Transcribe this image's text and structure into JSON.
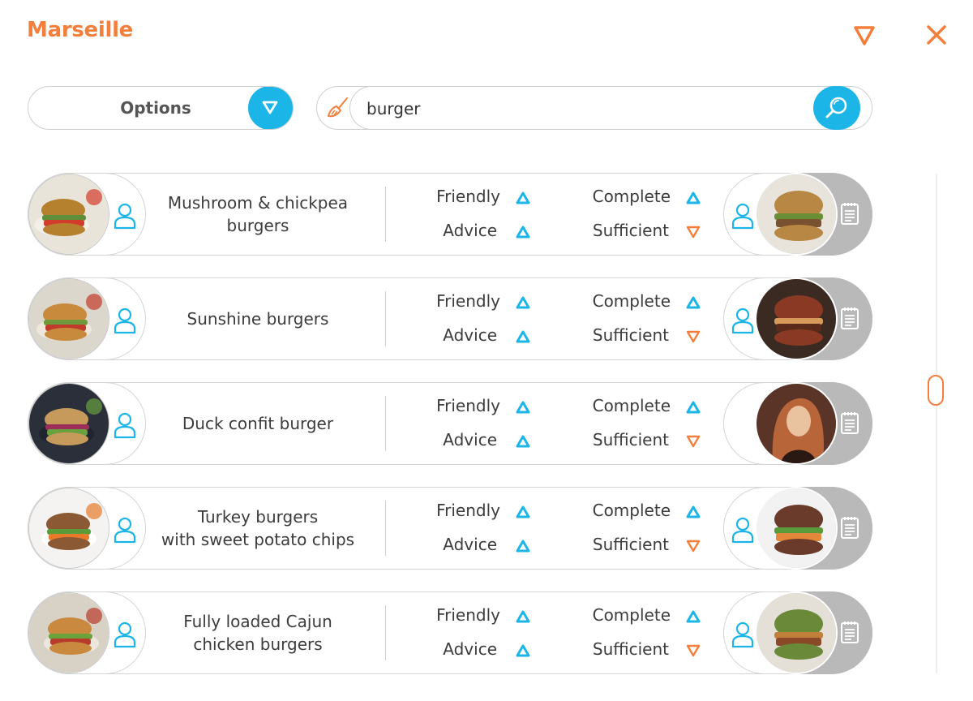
{
  "app": {
    "title": "Marseille"
  },
  "toolbar": {
    "options_label": "Options"
  },
  "search": {
    "value": "burger",
    "placeholder": ""
  },
  "colors": {
    "accent_orange": "#f47f3c",
    "accent_blue": "#1cb5e8",
    "row_grey": "#b9b9b9",
    "up_triangle": "#1cb5e8",
    "down_triangle": "#f47f3c"
  },
  "icons": {
    "top_right": [
      "filter-icon",
      "close-icon"
    ],
    "search": [
      "broom-icon",
      "search-icon"
    ],
    "row": [
      "food-photo",
      "user-icon",
      "triangle-up-icon",
      "triangle-down-icon",
      "profile-photo",
      "notes-icon"
    ]
  },
  "metric_labels": {
    "friendly": "Friendly",
    "advice": "Advice",
    "complete": "Complete",
    "sufficient": "Sufficient"
  },
  "recipes": [
    {
      "name": "Mushroom & chickpea\nburgers",
      "friendly": "up",
      "advice": "up",
      "complete": "up",
      "sufficient": "down",
      "right_user_icon": true
    },
    {
      "name": "Sunshine burgers",
      "friendly": "up",
      "advice": "up",
      "complete": "up",
      "sufficient": "down",
      "right_user_icon": true
    },
    {
      "name": "Duck confit burger",
      "friendly": "up",
      "advice": "up",
      "complete": "up",
      "sufficient": "down",
      "right_user_icon": false
    },
    {
      "name": "Turkey burgers\nwith sweet potato chips",
      "friendly": "up",
      "advice": "up",
      "complete": "up",
      "sufficient": "down",
      "right_user_icon": true
    },
    {
      "name": "Fully loaded Cajun\nchicken burgers",
      "friendly": "up",
      "advice": "up",
      "complete": "up",
      "sufficient": "down",
      "right_user_icon": true
    }
  ]
}
